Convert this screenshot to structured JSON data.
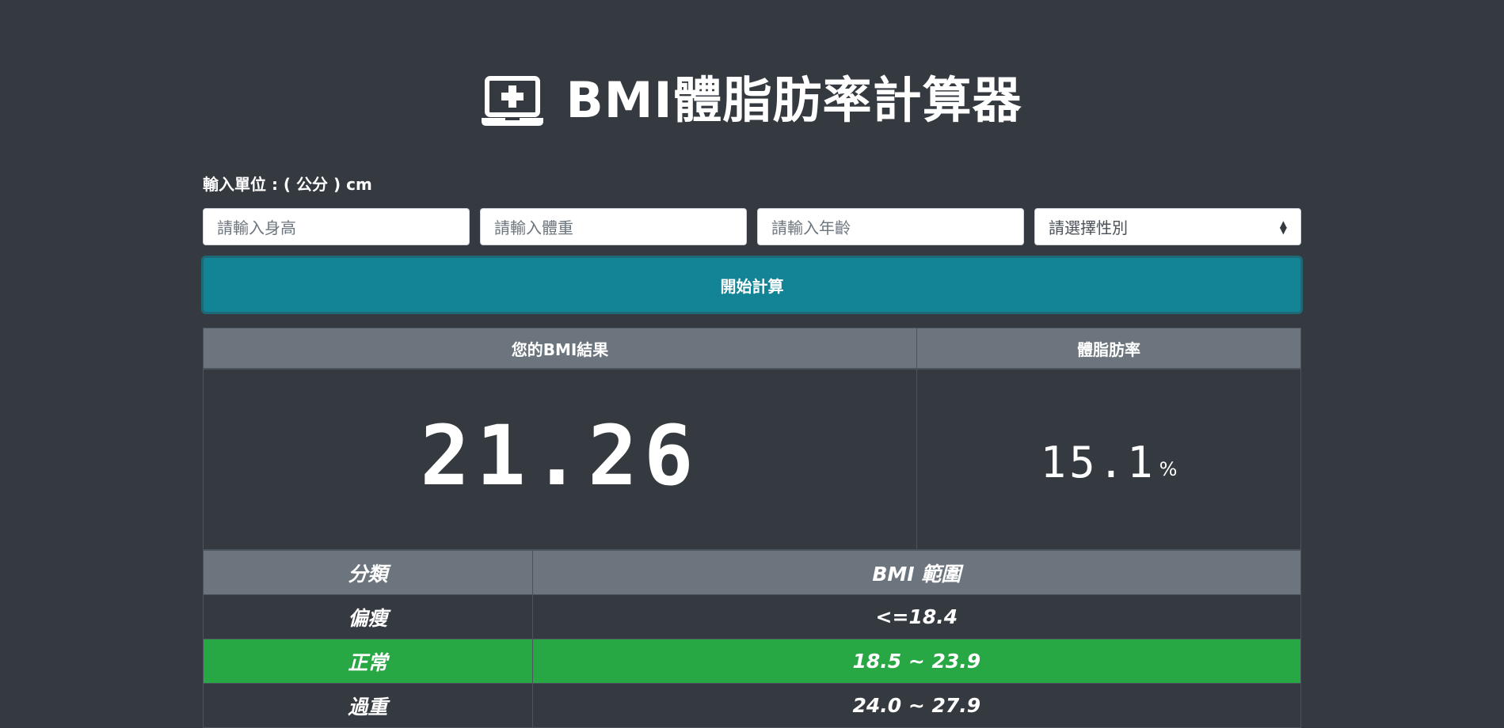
{
  "app": {
    "title": "BMI體脂肪率計算器",
    "title_icon": "laptop-medical-icon"
  },
  "form": {
    "unit_label": "輸入單位 : ( 公分 ) cm",
    "height_placeholder": "請輸入身高",
    "weight_placeholder": "請輸入體重",
    "age_placeholder": "請輸入年齡",
    "gender_selected": "請選擇性別",
    "gender_arrow_icon": "sort-arrows-icon",
    "calculate_label": "開始計算"
  },
  "results": {
    "bmi_header": "您的BMI結果",
    "fat_header": "體脂肪率",
    "bmi_value": "21.26",
    "fat_value": "15.1",
    "fat_unit": "%"
  },
  "ranges": {
    "headers": [
      "分類",
      "BMI 範圍"
    ],
    "rows": [
      {
        "category": "偏瘦",
        "range": "<=18.4",
        "active": false
      },
      {
        "category": "正常",
        "range": "18.5 ~ 23.9",
        "active": true
      },
      {
        "category": "過重",
        "range": "24.0 ~ 27.9",
        "active": false
      }
    ]
  },
  "colors": {
    "background": "#343a40",
    "button": "#138496",
    "header": "#6c757d",
    "active_row": "#28a745"
  }
}
